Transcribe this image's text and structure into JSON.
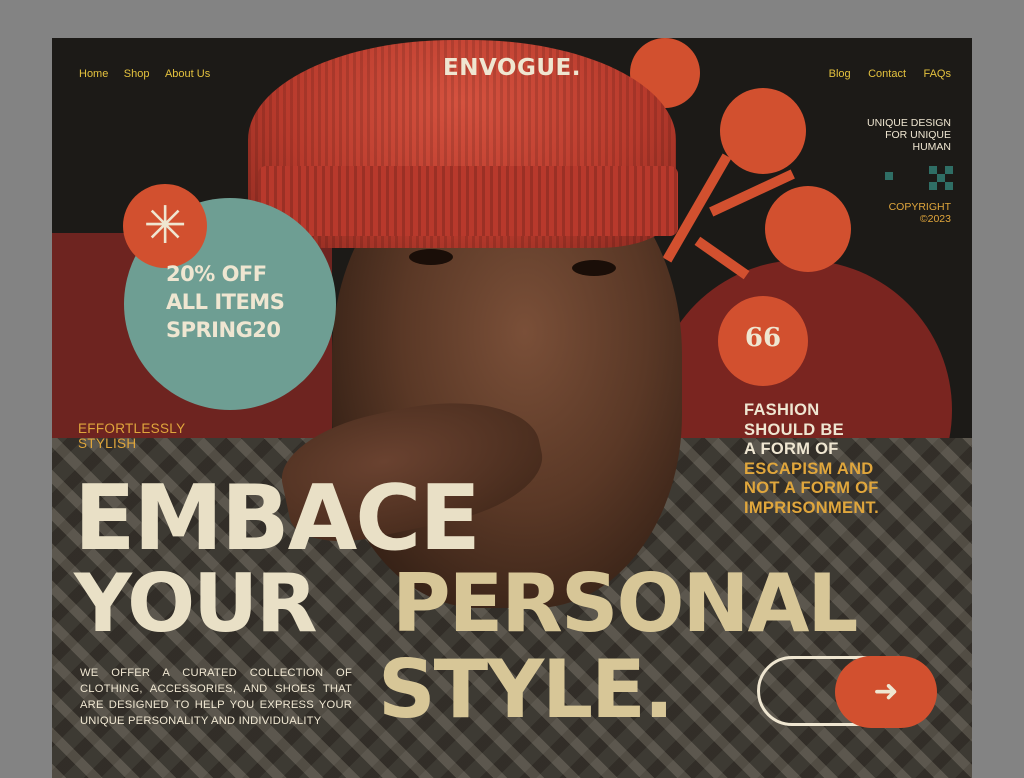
{
  "brand": {
    "logo": "ENVOGUE."
  },
  "nav": {
    "left": [
      "Home",
      "Shop",
      "About Us"
    ],
    "right": [
      "Blog",
      "Contact",
      "FAQs"
    ]
  },
  "tagline": {
    "lines": [
      "UNIQUE DESIGN",
      "FOR UNIQUE",
      "HUMAN"
    ]
  },
  "copyright": {
    "lines": [
      "COPYRIGHT",
      "©2023"
    ]
  },
  "promo": {
    "badge_icon": "asterisk-icon",
    "lines": [
      "20% OFF",
      "ALL ITEMS",
      "SPRING20"
    ]
  },
  "subheading": {
    "lines": [
      "EFFORTLESSLY",
      "STYLISH"
    ]
  },
  "quote": {
    "icon": "quote-icon",
    "icon_glyph": "66",
    "white_lines": [
      "FASHION",
      "SHOULD BE",
      "A FORM OF"
    ],
    "gold_lines": [
      "ESCAPISM AND",
      "NOT A FORM OF",
      "IMPRISONMENT."
    ]
  },
  "headline": {
    "line1": "EMBACE",
    "line2_part1": "YOUR",
    "line2_part2": "PERSONAL",
    "line3": "STYLE."
  },
  "description": "WE OFFER A CURATED COLLECTION OF CLOTHING, ACCESSORIES, AND SHOES THAT ARE DESIGNED TO HELP YOU EXPRESS YOUR UNIQUE PERSONALITY AND INDIVIDUALITY",
  "cta": {
    "icon": "arrow-right-icon",
    "glyph": "➜"
  },
  "colors": {
    "background": "#1c1a17",
    "accent_orange": "#d2502f",
    "gold": "#e0a63c",
    "teal": "#6e9e93",
    "cream": "#efe6d1"
  }
}
